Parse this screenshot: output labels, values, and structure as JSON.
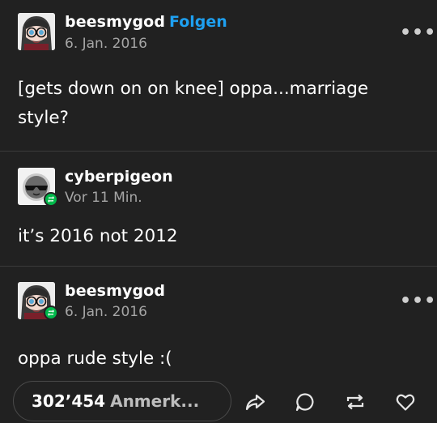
{
  "posts": [
    {
      "username": "beesmygod",
      "follow_label": "Folgen",
      "timestamp": "6. Jan. 2016",
      "body": "[gets down on on knee] oppa...marriage style?",
      "avatar": "anime-girl-glasses-avatar"
    },
    {
      "username": "cyberpigeon",
      "timestamp": "Vor 11 Min.",
      "body": "it’s 2016 not 2012",
      "avatar": "pigeon-sunglasses-avatar",
      "reblog_badge": "reblog-icon"
    },
    {
      "username": "beesmygod",
      "timestamp": "6. Jan. 2016",
      "body": "oppa rude style :(",
      "avatar": "anime-girl-glasses-avatar",
      "reblog_badge": "reblog-icon"
    }
  ],
  "footer": {
    "notes_count": "302’454",
    "notes_label": "Anmerk...",
    "actions": [
      "share-icon",
      "reply-icon",
      "reblog-icon",
      "like-icon"
    ]
  },
  "colors": {
    "background": "#212121",
    "text": "#ffffff",
    "muted": "#a6a6a6",
    "follow": "#1ea0f0",
    "reblog_badge": "#00b84a",
    "divider": "#3a3a3a"
  },
  "more_menu_glyph": "•••"
}
